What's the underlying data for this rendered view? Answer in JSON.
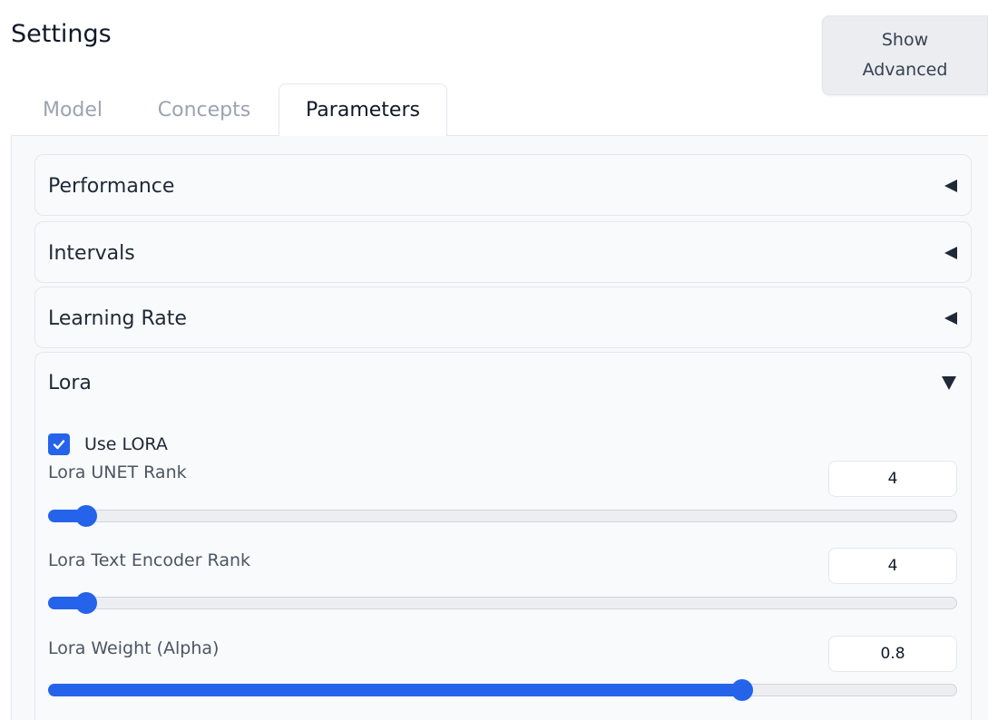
{
  "header": {
    "title": "Settings",
    "advanced_button": "Show Advanced"
  },
  "tabs": [
    {
      "label": "Model",
      "active": false
    },
    {
      "label": "Concepts",
      "active": false
    },
    {
      "label": "Parameters",
      "active": true
    }
  ],
  "accordions": [
    {
      "label": "Performance",
      "expanded": false
    },
    {
      "label": "Intervals",
      "expanded": false
    },
    {
      "label": "Learning Rate",
      "expanded": false
    },
    {
      "label": "Lora",
      "expanded": true
    }
  ],
  "lora": {
    "use_lora": {
      "label": "Use LORA",
      "checked": true
    },
    "unet_rank": {
      "label": "Lora UNET Rank",
      "value": "4",
      "slider_fraction": 0.03
    },
    "text_encoder_rank": {
      "label": "Lora Text Encoder Rank",
      "value": "4",
      "slider_fraction": 0.03
    },
    "weight": {
      "label": "Lora Weight (Alpha)",
      "value": "0.8",
      "slider_fraction": 0.77
    }
  },
  "colors": {
    "accent": "#2563eb",
    "panel_background": "#f8f9fa"
  }
}
